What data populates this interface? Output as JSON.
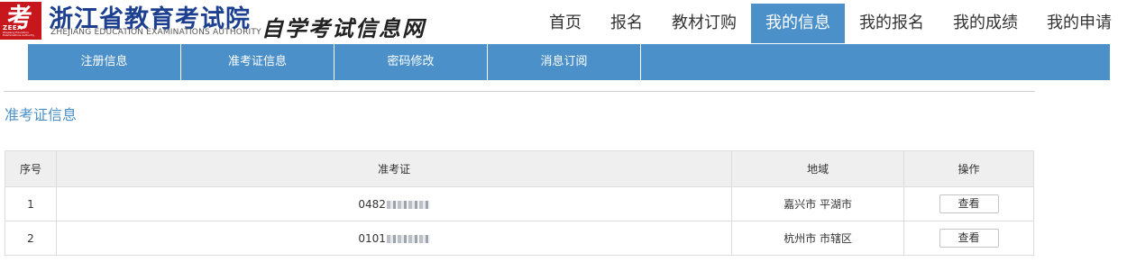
{
  "logo": {
    "mark_char": "考",
    "abbr": "ZEEA",
    "tiny_text": "Zhejiang Education Examinations Authority"
  },
  "header": {
    "org_name": "浙江省教育考试院",
    "org_en": "ZHEJIANG EDUCATION EXAMINATIONS AUTHORITY",
    "site_name": "自学考试信息网"
  },
  "topnav": {
    "items": [
      {
        "label": "首页"
      },
      {
        "label": "报名"
      },
      {
        "label": "教材订购"
      },
      {
        "label": "我的信息"
      },
      {
        "label": "我的报名"
      },
      {
        "label": "我的成绩"
      },
      {
        "label": "我的申请"
      }
    ],
    "active_index": 3
  },
  "subnav": {
    "items": [
      {
        "label": "注册信息"
      },
      {
        "label": "准考证信息"
      },
      {
        "label": "密码修改"
      },
      {
        "label": "消息订阅"
      }
    ]
  },
  "section": {
    "title": "准考证信息"
  },
  "table": {
    "headers": [
      "序号",
      "准考证",
      "地域",
      "操作"
    ],
    "rows": [
      {
        "index": "1",
        "ticket_prefix": "0482",
        "region": "嘉兴市 平湖市",
        "action": "查看"
      },
      {
        "index": "2",
        "ticket_prefix": "0101",
        "region": "杭州市 市辖区",
        "action": "查看"
      }
    ]
  },
  "colors": {
    "accent": "#4b90c9",
    "logo_red": "#c8161d",
    "org_blue": "#1c3f8f",
    "header_bg": "#efefef"
  }
}
